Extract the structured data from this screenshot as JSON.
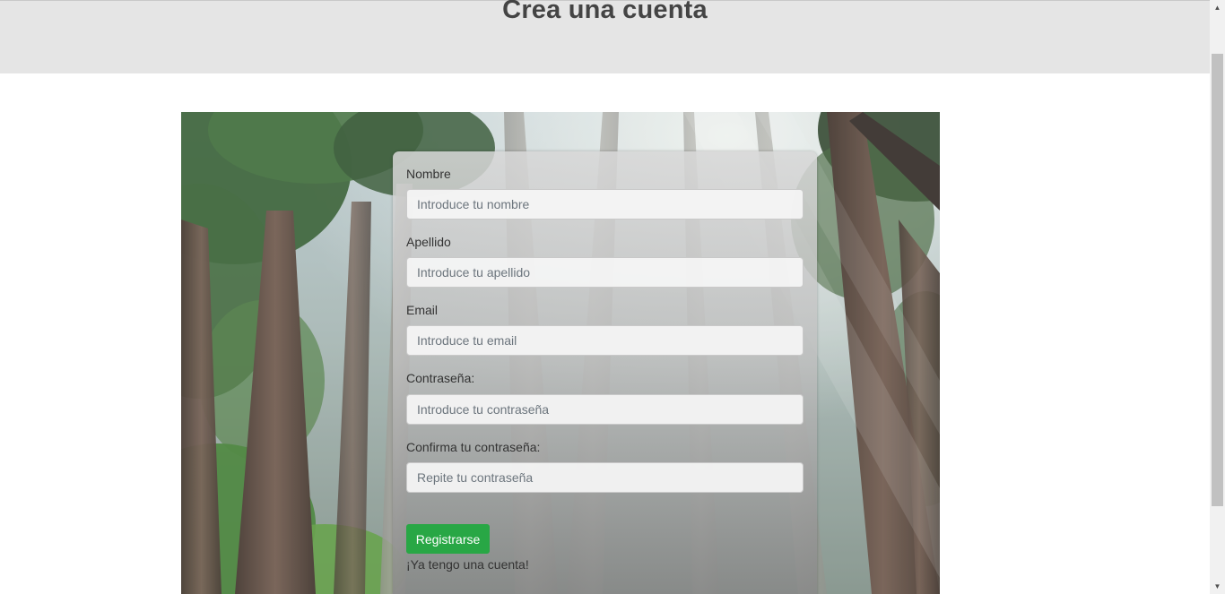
{
  "header": {
    "title": "Crea una cuenta"
  },
  "hero": {
    "icon": "forest-photo"
  },
  "form": {
    "fields": [
      {
        "label": "Nombre",
        "placeholder": "Introduce tu nombre",
        "value": ""
      },
      {
        "label": "Apellido",
        "placeholder": "Introduce tu apellido",
        "value": ""
      },
      {
        "label": "Email",
        "placeholder": "Introduce tu email",
        "value": ""
      },
      {
        "label": "Contraseña:",
        "placeholder": "Introduce tu contraseña",
        "value": ""
      },
      {
        "label": "Confirma tu contraseña:",
        "placeholder": "Repite tu contraseña",
        "value": ""
      }
    ],
    "submit_label": "Registrarse",
    "login_link": "¡Ya tengo una cuenta!"
  },
  "scrollbar": {
    "up_icon": "triangle-up-icon",
    "down_icon": "triangle-down-icon"
  },
  "colors": {
    "header_bg": "#e5e5e5",
    "title": "#444444",
    "button": "#28a745"
  }
}
